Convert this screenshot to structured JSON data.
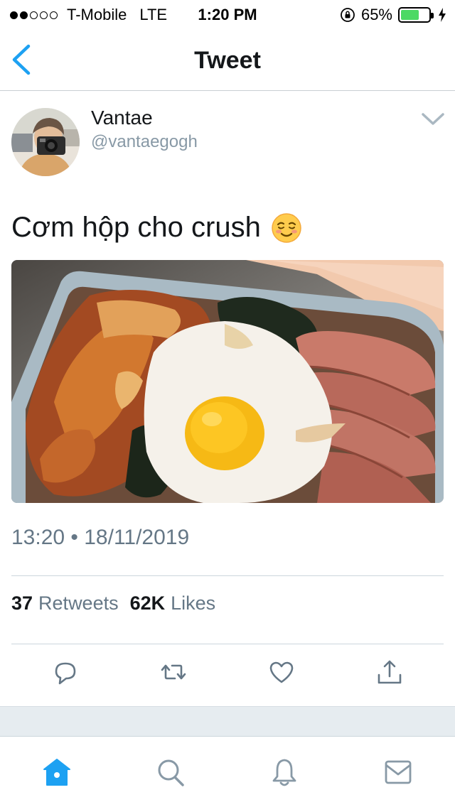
{
  "status_bar": {
    "signal_filled": 2,
    "signal_total": 5,
    "carrier": "T-Mobile",
    "network": "LTE",
    "time": "1:20 PM",
    "battery_percent": "65%",
    "battery_level": 0.65
  },
  "nav": {
    "title": "Tweet",
    "back_icon": "chevron-left-icon"
  },
  "tweet": {
    "user": {
      "name": "Vantae",
      "handle": "@vantaegogh"
    },
    "text": "Cơm hộp cho crush",
    "emoji": "smiling-face-icon",
    "timestamp": "13:20 • 18/11/2019",
    "stats": {
      "retweets_count": "37",
      "retweets_label": "Retweets",
      "likes_count": "62K",
      "likes_label": "Likes"
    },
    "actions": [
      "reply-icon",
      "retweet-icon",
      "like-icon",
      "share-icon"
    ]
  },
  "tabbar": {
    "tabs": [
      "home-icon",
      "search-icon",
      "notifications-icon",
      "messages-icon"
    ],
    "active_tab": "home-icon"
  },
  "colors": {
    "accent": "#1da1f2",
    "secondary_text": "#657786",
    "handle_text": "#8899a6",
    "battery": "#4cd964"
  }
}
